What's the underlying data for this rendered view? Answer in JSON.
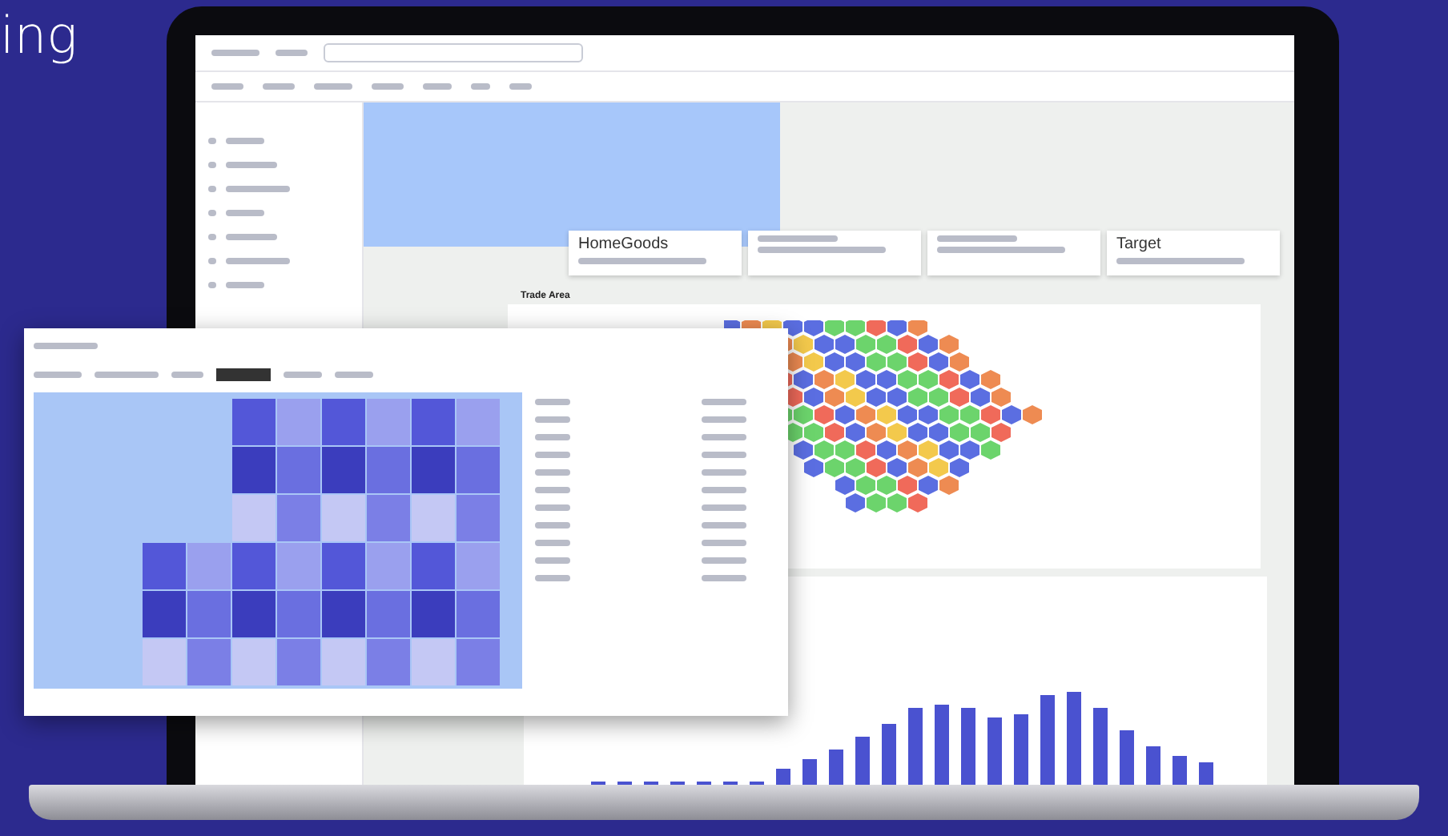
{
  "headline": "ing",
  "app": {
    "store_cards": [
      {
        "kind": "named",
        "name": "HomeGoods"
      },
      {
        "kind": "blurred"
      },
      {
        "kind": "blurred"
      },
      {
        "kind": "named",
        "name": "Target"
      }
    ],
    "section_title": "Trade Area"
  }
}
